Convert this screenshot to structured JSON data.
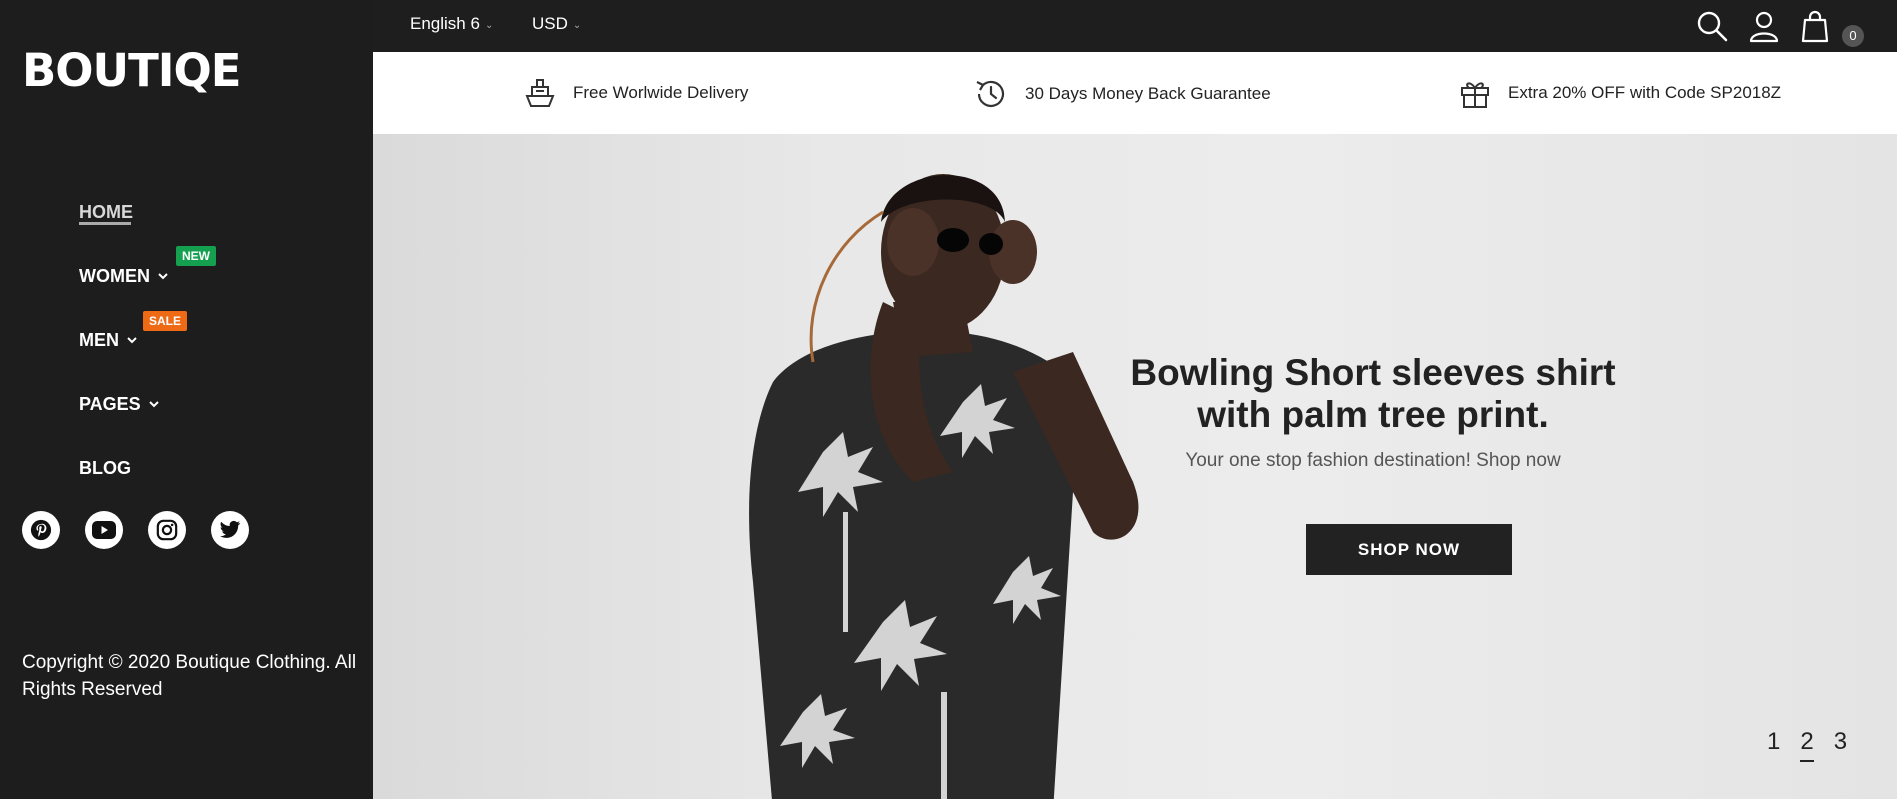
{
  "brand": {
    "logo_text": "BOUTIQE"
  },
  "nav": {
    "items": [
      {
        "label": "HOME",
        "active": true
      },
      {
        "label": "WOMEN",
        "has_dropdown": true,
        "badge": "NEW"
      },
      {
        "label": "MEN",
        "has_dropdown": true,
        "badge": "SALE"
      },
      {
        "label": "PAGES",
        "has_dropdown": true
      },
      {
        "label": "BLOG"
      }
    ]
  },
  "social": [
    "pinterest-icon",
    "youtube-icon",
    "instagram-icon",
    "twitter-icon"
  ],
  "copyright": "Copyright © 2020 Boutique Clothing. All Rights Reserved",
  "topbar": {
    "language": "English 6",
    "currency": "USD",
    "cart_count": "0"
  },
  "features": [
    {
      "icon": "ship-icon",
      "text": "Free Worlwide Delivery"
    },
    {
      "icon": "history-icon",
      "text": "30 Days Money Back Guarantee"
    },
    {
      "icon": "gift-icon",
      "text": "Extra 20% OFF with Code SP2018Z"
    }
  ],
  "hero": {
    "title_line1": "Bowling Short sleeves shirt",
    "title_line2": "with palm tree print.",
    "subtitle": "Your one stop fashion destination! Shop now",
    "cta": "SHOP NOW",
    "pages": [
      "1",
      "2",
      "3"
    ],
    "active_page": "2"
  },
  "colors": {
    "sidebar_bg": "#1d1d1d",
    "new_badge": "#15a050",
    "sale_badge": "#ee6a15",
    "cta_bg": "#222222"
  }
}
